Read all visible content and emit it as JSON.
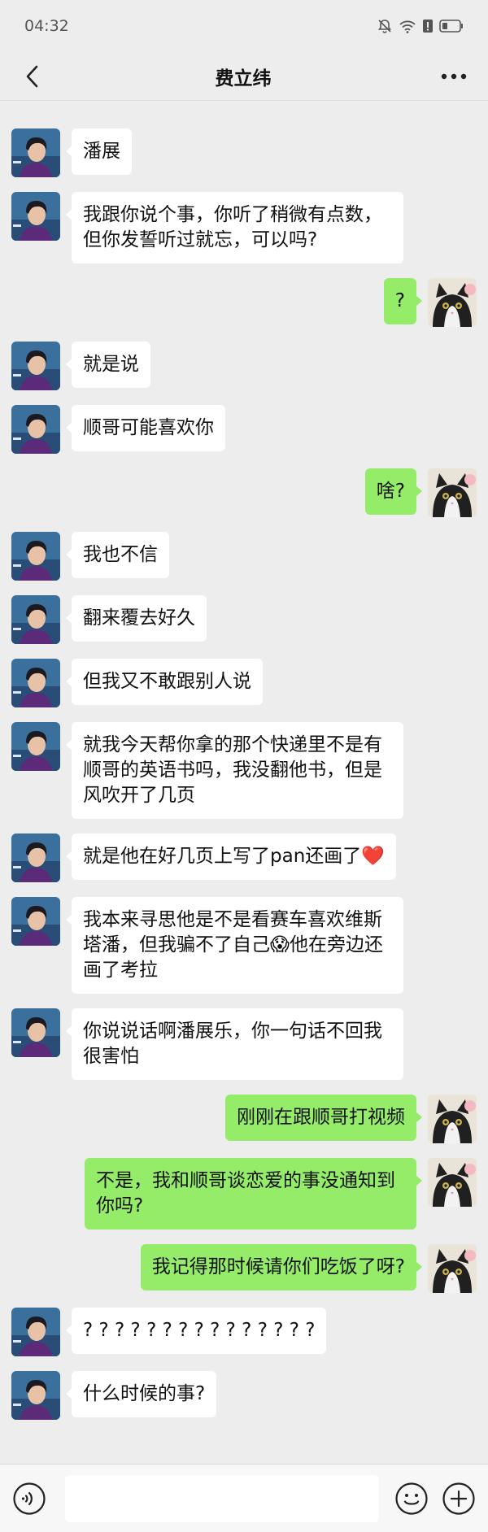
{
  "status": {
    "time": "04:32"
  },
  "header": {
    "title": "费立纬"
  },
  "messages": [
    {
      "side": "left",
      "text": "潘展"
    },
    {
      "side": "left",
      "text": "我跟你说个事，你听了稍微有点数，但你发誓听过就忘，可以吗?"
    },
    {
      "side": "right",
      "text": "?"
    },
    {
      "side": "left",
      "text": "就是说"
    },
    {
      "side": "left",
      "text": "顺哥可能喜欢你"
    },
    {
      "side": "right",
      "text": "啥?"
    },
    {
      "side": "left",
      "text": "我也不信"
    },
    {
      "side": "left",
      "text": "翻来覆去好久"
    },
    {
      "side": "left",
      "text": "但我又不敢跟别人说"
    },
    {
      "side": "left",
      "text": "就我今天帮你拿的那个快递里不是有顺哥的英语书吗，我没翻他书，但是风吹开了几页"
    },
    {
      "side": "left",
      "text": "就是他在好几页上写了pan还画了❤️"
    },
    {
      "side": "left",
      "text": "我本来寻思他是不是看赛车喜欢维斯塔潘，但我骗不了自己😱他在旁边还画了考拉"
    },
    {
      "side": "left",
      "text": "你说说话啊潘展乐，你一句话不回我很害怕"
    },
    {
      "side": "right",
      "text": "刚刚在跟顺哥打视频"
    },
    {
      "side": "right",
      "text": "不是，我和顺哥谈恋爱的事没通知到你吗?"
    },
    {
      "side": "right",
      "text": "我记得那时候请你们吃饭了呀?"
    },
    {
      "side": "left",
      "text": "? ? ? ? ? ? ? ? ? ? ? ? ? ? ?"
    },
    {
      "side": "left",
      "text": "什么时候的事?"
    }
  ],
  "colors": {
    "my_bubble": "#95ec69",
    "their_bubble": "#ffffff",
    "background": "#ededed"
  }
}
